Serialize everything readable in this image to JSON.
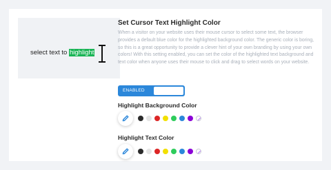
{
  "preview": {
    "text_before": "select text to ",
    "highlighted": "highlight"
  },
  "setting": {
    "title": "Set Cursor Text Highlight Color",
    "description": "When a visitor on your website uses their mouse cursor to select some text, the browser provides a default blue color for the highlighted background color. The generic color is boring, so this is a great opportunity to provide a clever hint of your own branding by using your own colors! With this setting enabled, you can set the color of the highlighted text background and text color when anyone uses their mouse to click and drag to select words on your website.",
    "toggle_label": "ENABLED"
  },
  "background_color": {
    "label": "Highlight Background Color",
    "swatches": [
      "#2b2b2b",
      "#e5e5e5",
      "#dc2626",
      "#f2e000",
      "#2ecc5c",
      "#2b87da",
      "#8b00d6"
    ]
  },
  "text_color": {
    "label": "Highlight Text Color",
    "swatches": [
      "#2b2b2b",
      "#e5e5e5",
      "#dc2626",
      "#f2e000",
      "#2ecc5c",
      "#2b87da",
      "#8b00d6"
    ]
  },
  "icons": {
    "picker": "eyedropper-icon",
    "reset": "no-color-icon",
    "cursor": "text-cursor-icon"
  },
  "colors": {
    "accent": "#2b87da",
    "highlight": "#19b455"
  }
}
